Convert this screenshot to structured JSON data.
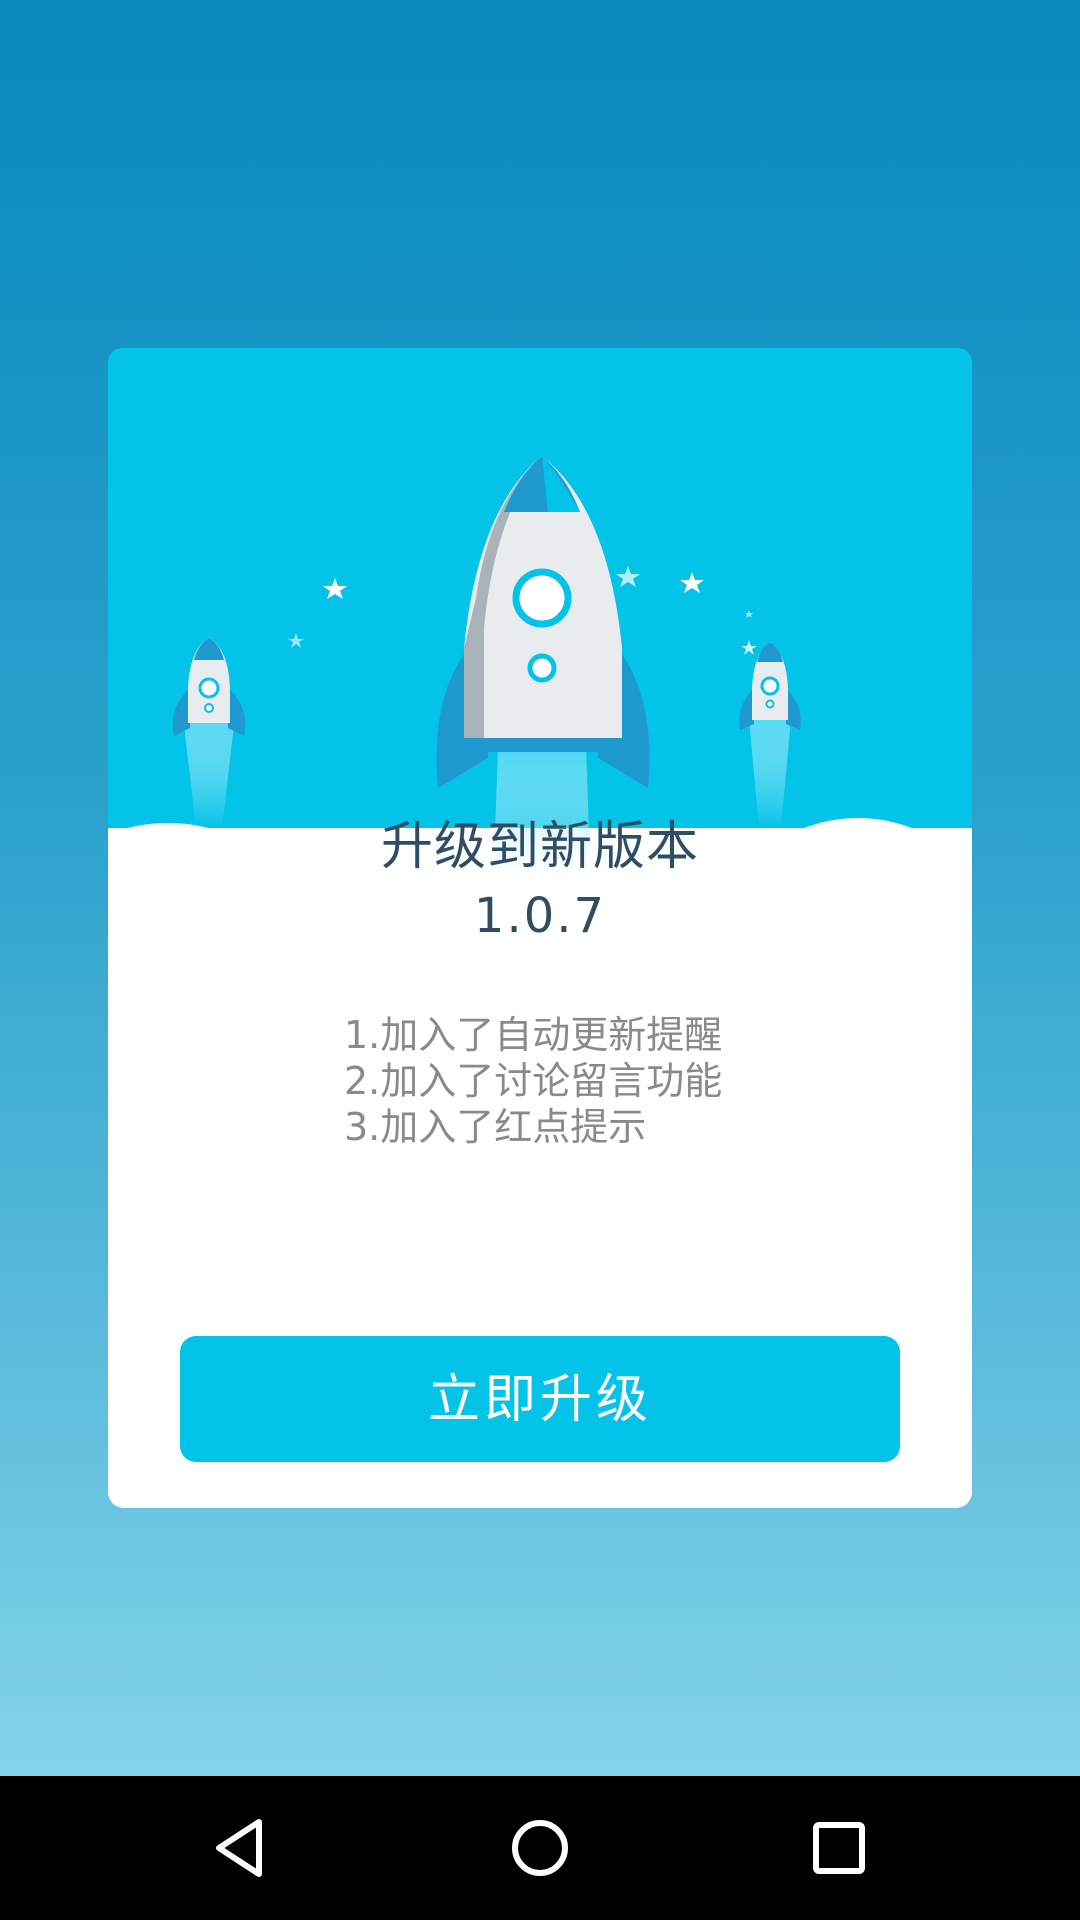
{
  "dialog": {
    "title": "升级到新版本",
    "version": "1.0.7",
    "notes": [
      "1.加入了自动更新提醒",
      "2.加入了讨论留言功能",
      "3.加入了红点提示"
    ],
    "button_label": "立即升级"
  },
  "navbar": {
    "back_icon": "back-triangle-icon",
    "home_icon": "home-circle-icon",
    "recent_icon": "recent-square-icon"
  },
  "colors": {
    "background_top": "#0888bd",
    "background_bottom": "#82d5ea",
    "header_sky": "#03c3e8",
    "button": "#03c3e8",
    "title_text": "#2f4e66",
    "notes_text": "#8a8a8a"
  }
}
